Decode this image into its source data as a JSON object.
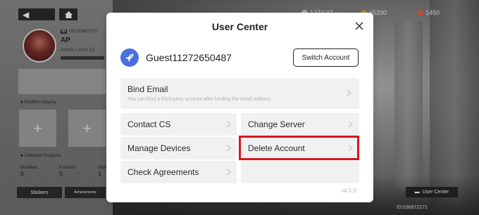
{
  "background": {
    "uid_tag": "ID",
    "uid_value": "UID:536872271",
    "player_name": "AP",
    "admin_level": "Admin Level 12",
    "modifiers_display_label": "Modifiers Display",
    "collection_progress_label": "Collection Progress",
    "slot_plus": "+",
    "stats": [
      {
        "label": "Modifiers",
        "value": "5"
      },
      {
        "label": "Functors",
        "value": "5"
      },
      {
        "label": "Stick",
        "value": "1"
      }
    ],
    "stickers_label": "Stickers",
    "achievements_label": "Achievements",
    "resources": [
      {
        "value": "127/137",
        "color": "#cfcfcf"
      },
      {
        "value": "65200",
        "color": "#e0a040"
      },
      {
        "value": "1450",
        "color": "#e8604a"
      }
    ],
    "user_center_btn": "User Center",
    "bottom_id": "ID:536872271"
  },
  "dialog": {
    "title": "User Center",
    "guest_name": "Guest11272650487",
    "switch_account": "Switch Account",
    "bind_email": "Bind Email",
    "bind_email_sub": "You can bind a third-party account after binding the email address",
    "contact_cs": "Contact CS",
    "change_server": "Change Server",
    "manage_devices": "Manage Devices",
    "delete_account": "Delete Account",
    "check_agreements": "Check Agreements",
    "version": "v4.5.0",
    "accent_color": "#4a6fe3",
    "highlight_color": "#d8151b"
  }
}
